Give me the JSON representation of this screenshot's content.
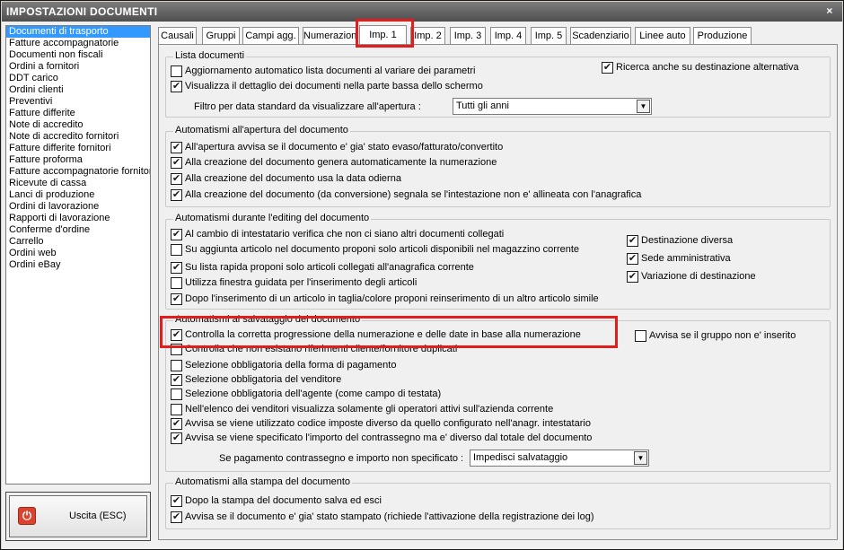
{
  "window": {
    "title": "IMPOSTAZIONI DOCUMENTI",
    "close_label": "×"
  },
  "doc_list": [
    "Documenti di trasporto",
    "Fatture accompagnatorie",
    "Documenti non fiscali",
    "Ordini a fornitori",
    "DDT carico",
    "Ordini clienti",
    "Preventivi",
    "Fatture differite",
    "Note di accredito",
    "Note di accredito fornitori",
    "Fatture differite fornitori",
    "Fatture proforma",
    "Fatture accompagnatorie fornitori",
    "Ricevute di cassa",
    "Lanci di produzione",
    "Ordini di lavorazione",
    "Rapporti di lavorazione",
    "Conferme d'ordine",
    "Carrello",
    "Ordini web",
    "Ordini eBay"
  ],
  "exit_button": {
    "label": "Uscita (ESC)",
    "icon": "power-icon"
  },
  "tabs": [
    "Causali",
    "Gruppi",
    "Campi agg.",
    "Numerazioni",
    "Imp. 1",
    "Imp. 2",
    "Imp. 3",
    "Imp. 4",
    "Imp. 5",
    "Scadenziario",
    "Linee auto",
    "Produzione"
  ],
  "active_tab": "Imp. 1",
  "highlight_color": "#e01e1e",
  "groups": {
    "lista": {
      "title": "Lista documenti",
      "cb_auto_update": {
        "label": "Aggiornamento automatico lista documenti al variare dei parametri",
        "checked": false
      },
      "cb_show_detail": {
        "label": "Visualizza il dettaglio dei documenti nella parte bassa dello schermo",
        "checked": true
      },
      "cb_search_alt": {
        "label": "Ricerca anche su destinazione alternativa",
        "checked": true
      },
      "filter_label": "Filtro per data standard da visualizzare all'apertura :",
      "filter_value": "Tutti gli anni"
    },
    "apertura": {
      "title": "Automatismi all'apertura del documento",
      "cb_1": {
        "label": "All'apertura avvisa se il documento e' gia' stato evaso/fatturato/convertito",
        "checked": true
      },
      "cb_2": {
        "label": "Alla creazione del documento genera automaticamente la numerazione",
        "checked": true
      },
      "cb_3": {
        "label": "Alla creazione del documento usa la data odierna",
        "checked": true
      },
      "cb_4": {
        "label": "Alla creazione del documento (da conversione) segnala se l'intestazione non e' allineata con l'anagrafica",
        "checked": true
      }
    },
    "editing": {
      "title": "Automatismi durante l'editing del documento",
      "cb_1": {
        "label": "Al cambio di intestatario verifica che non ci siano altri documenti collegati",
        "checked": true
      },
      "cb_2": {
        "label": "Su aggiunta articolo nel documento proponi solo articoli disponibili nel magazzino corrente",
        "checked": false
      },
      "cb_3": {
        "label": "Su lista rapida proponi solo articoli collegati all'anagrafica corrente",
        "checked": true
      },
      "cb_4": {
        "label": "Utilizza finestra guidata per l'inserimento degli articoli",
        "checked": false
      },
      "cb_5": {
        "label": "Dopo l'inserimento di un articolo in taglia/colore proponi reinserimento di un altro articolo simile",
        "checked": true
      },
      "cb_dest": {
        "label": "Destinazione diversa",
        "checked": true
      },
      "cb_sede": {
        "label": "Sede amministrativa",
        "checked": true
      },
      "cb_var": {
        "label": "Variazione di destinazione",
        "checked": true
      }
    },
    "salvataggio": {
      "title": "Automatismi al salvataggio del documento",
      "cb_1": {
        "label": "Controlla la corretta progressione della numerazione e delle date in base alla numerazione",
        "checked": true
      },
      "cb_2": {
        "label": "Controlla che non esistano riferimenti cliente/fornitore duplicati",
        "checked": false
      },
      "cb_3": {
        "label": "Selezione obbligatoria della forma di pagamento",
        "checked": false
      },
      "cb_4": {
        "label": "Selezione obbligatoria del venditore",
        "checked": true
      },
      "cb_5": {
        "label": "Selezione obbligatoria dell'agente (come campo di testata)",
        "checked": false
      },
      "cb_6": {
        "label": "Nell'elenco dei venditori visualizza solamente gli operatori attivi sull'azienda corrente",
        "checked": false
      },
      "cb_7": {
        "label": "Avvisa se viene utilizzato codice imposte diverso da quello configurato nell'anagr. intestatario",
        "checked": true
      },
      "cb_8": {
        "label": "Avvisa se viene specificato l'importo del contrassegno ma e' diverso dal totale del documento",
        "checked": true
      },
      "cb_group": {
        "label": "Avvisa se il gruppo non e' inserito",
        "checked": false
      },
      "payment_label": "Se pagamento contrassegno e importo non specificato :",
      "payment_value": "Impedisci salvataggio"
    },
    "stampa": {
      "title": "Automatismi alla stampa del documento",
      "cb_1": {
        "label": "Dopo la stampa del documento salva ed esci",
        "checked": true
      },
      "cb_2": {
        "label": "Avvisa se il documento e' gia' stato stampato (richiede l'attivazione della registrazione dei log)",
        "checked": true
      }
    }
  }
}
